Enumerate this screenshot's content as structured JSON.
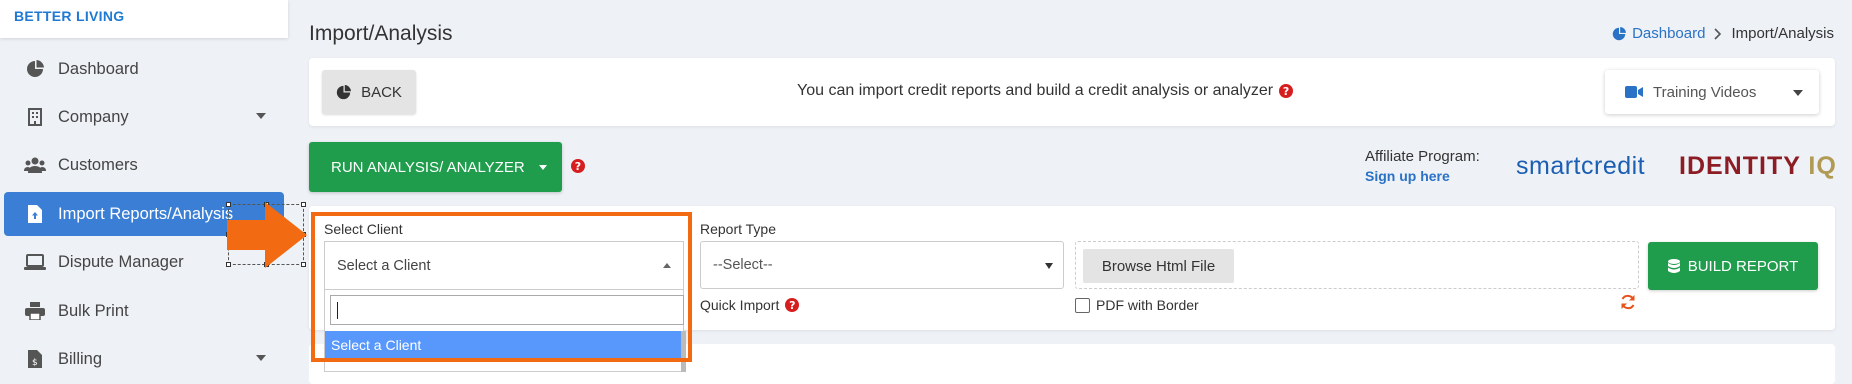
{
  "brand": {
    "name": "BETTER LIVING"
  },
  "sidebar": {
    "items": [
      {
        "label": "Dashboard",
        "icon": "pie-chart-icon",
        "active": false,
        "has_caret": false
      },
      {
        "label": "Company",
        "icon": "building-icon",
        "active": false,
        "has_caret": true
      },
      {
        "label": "Customers",
        "icon": "users-icon",
        "active": false,
        "has_caret": false
      },
      {
        "label": "Import Reports/Analysis",
        "icon": "file-upload-icon",
        "active": true,
        "has_caret": false
      },
      {
        "label": "Dispute Manager",
        "icon": "laptop-icon",
        "active": false,
        "has_caret": false
      },
      {
        "label": "Bulk Print",
        "icon": "printer-icon",
        "active": false,
        "has_caret": false
      },
      {
        "label": "Billing",
        "icon": "invoice-icon",
        "active": false,
        "has_caret": true
      }
    ]
  },
  "page": {
    "title": "Import/Analysis"
  },
  "breadcrumb": {
    "home": "Dashboard",
    "current": "Import/Analysis"
  },
  "toolbar": {
    "back_label": "BACK",
    "info_text": "You can import credit reports and build a credit analysis or analyzer",
    "training_label": "Training Videos"
  },
  "run_button": {
    "label": "RUN ANALYSIS/ ANALYZER"
  },
  "affiliate": {
    "label": "Affiliate Program:",
    "link": "Sign up here",
    "smartcredit": "smartcredit",
    "identity": "IDENTITY",
    "iq": "IQ"
  },
  "form": {
    "select_client_label": "Select Client",
    "select_client_value": "Select a Client",
    "dropdown_search_value": "",
    "dropdown_options": [
      "Select a Client"
    ],
    "report_type_label": "Report Type",
    "report_type_value": "--Select--",
    "quick_import_label": "Quick Import",
    "browse_label": "Browse Html File",
    "pdf_border_label": "PDF with Border",
    "pdf_border_checked": false,
    "build_label": "BUILD REPORT"
  },
  "colors": {
    "accent_blue": "#3a7fd5",
    "green": "#1f9d4d",
    "highlight_orange": "#f26b12",
    "option_blue": "#5897fb",
    "help_red": "#d61e1e"
  }
}
